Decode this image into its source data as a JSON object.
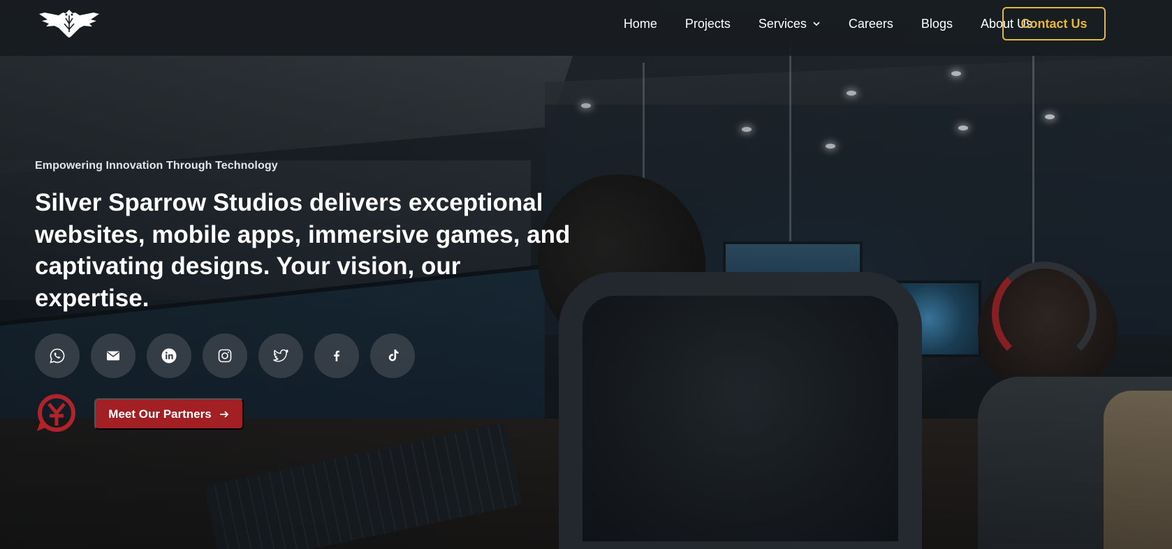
{
  "navbar": {
    "logo_icon": "sparrow-logo-icon",
    "links": [
      "Home",
      "Projects",
      "Services",
      "Careers",
      "Blogs",
      "About Us"
    ],
    "services_icon": "chevron-down-icon",
    "contact_label": "Contact Us"
  },
  "hero": {
    "tagline": "Empowering Innovation Through Technology",
    "headline": "Silver Sparrow Studios delivers exceptional websites, mobile apps, immersive games, and captivating designs. Your vision, our expertise.",
    "socials": [
      "whatsapp-icon",
      "email-icon",
      "linkedin-icon",
      "instagram-icon",
      "twitter-icon",
      "facebook-icon",
      "tiktok-icon"
    ],
    "partner_logo_icon": "partner-logo-icon",
    "partners_button": "Meet Our Partners",
    "partners_arrow_icon": "arrow-right-icon"
  },
  "colors": {
    "accent_gold": "#e5b73b",
    "partner_red": "#a21f24",
    "nav_bg": "#181c21"
  }
}
